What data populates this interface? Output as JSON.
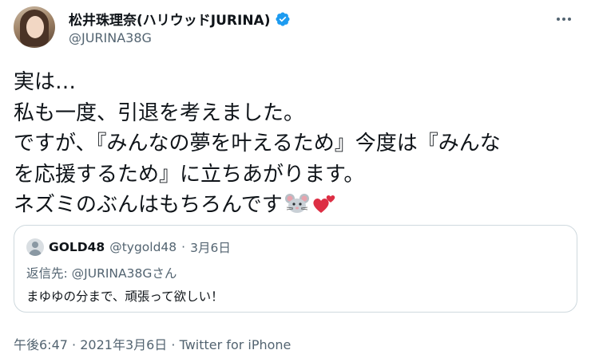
{
  "user": {
    "display_name": "松井珠理奈(ハリウッドJURINA)",
    "handle": "@JURINA38G",
    "verified": true
  },
  "tweet": {
    "lines": [
      "実は…",
      "私も一度、引退を考えました。",
      "ですが、『みんなの夢を叶えるため』今度は『みんな",
      "を応援するため』に立ちあがります。",
      "ネズミのぶんはもちろんです"
    ],
    "emojis": [
      "mouse-face-emoji",
      "two-hearts-emoji"
    ]
  },
  "quote": {
    "name": "GOLD48",
    "handle": "@tygold48",
    "separator": "·",
    "date": "3月6日",
    "reply_to": "返信先: @JURINA38Gさん",
    "text": "まゆゆの分まで、頑張って欲しい！"
  },
  "meta": {
    "time": "午後6:47",
    "separator": "·",
    "date": "2021年3月6日",
    "source": "Twitter for iPhone"
  },
  "colors": {
    "text": "#0f1419",
    "secondary": "#536471",
    "verified": "#1d9bf0",
    "border": "#cfd9de"
  }
}
